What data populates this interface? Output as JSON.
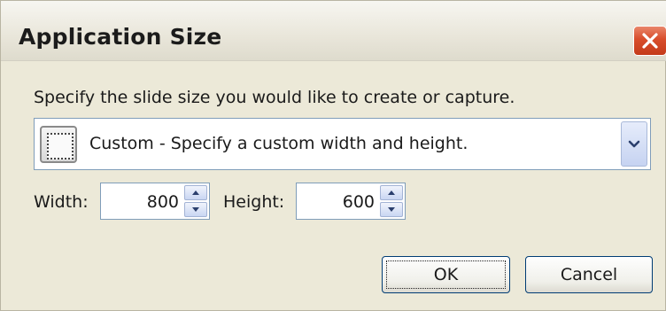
{
  "window": {
    "title": "Application Size"
  },
  "instruction": "Specify the slide size you would like to create or capture.",
  "size_preset": {
    "selected": "Custom - Specify a custom width and height.",
    "icon": "custom-size-icon"
  },
  "width": {
    "label": "Width:",
    "value": "800"
  },
  "height": {
    "label": "Height:",
    "value": "600"
  },
  "buttons": {
    "ok": "OK",
    "cancel": "Cancel"
  },
  "colors": {
    "close_button": "#d84d2b",
    "dialog_background": "#ece9d8",
    "input_border": "#7f9db9"
  }
}
